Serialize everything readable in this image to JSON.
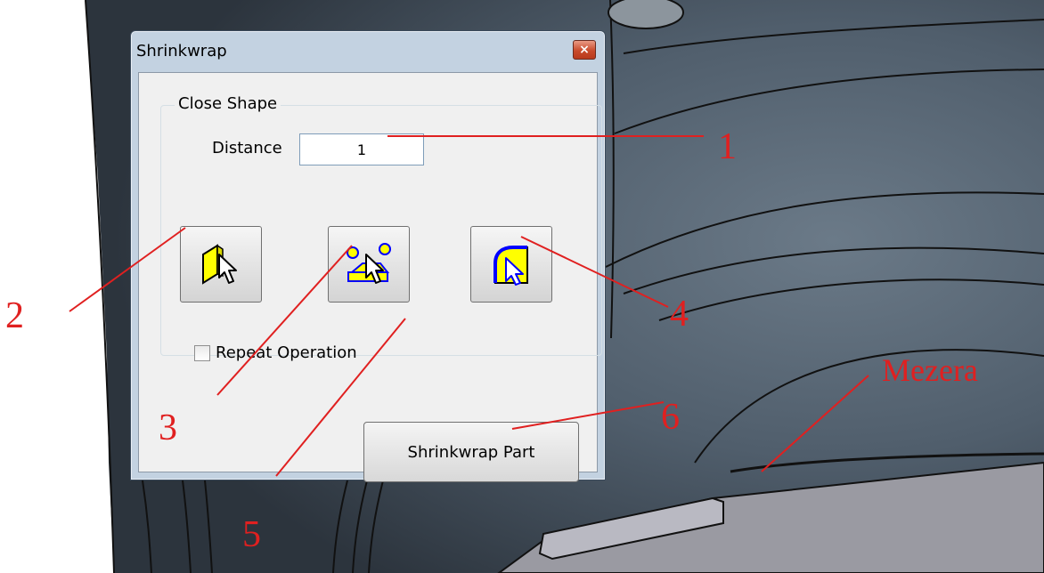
{
  "dialog": {
    "title": "Shrinkwrap",
    "close_icon": "×",
    "group_label": "Close Shape",
    "distance_label": "Distance",
    "distance_value": "1",
    "tools": [
      {
        "icon": "select-face-icon"
      },
      {
        "icon": "select-features-icon"
      },
      {
        "icon": "select-edge-icon"
      }
    ],
    "repeat_label": "Repeat Operation",
    "repeat_checked": false,
    "shrinkwrap_button": "Shrinkwrap Part"
  },
  "annotations": {
    "callouts": [
      "1",
      "2",
      "3",
      "4",
      "5",
      "6"
    ],
    "gap_label": "Mezera",
    "color": "#e02020"
  },
  "colors": {
    "highlight_yellow": "#ffff00",
    "icon_blue": "#0000ff",
    "cad_background": "#4a5866"
  }
}
